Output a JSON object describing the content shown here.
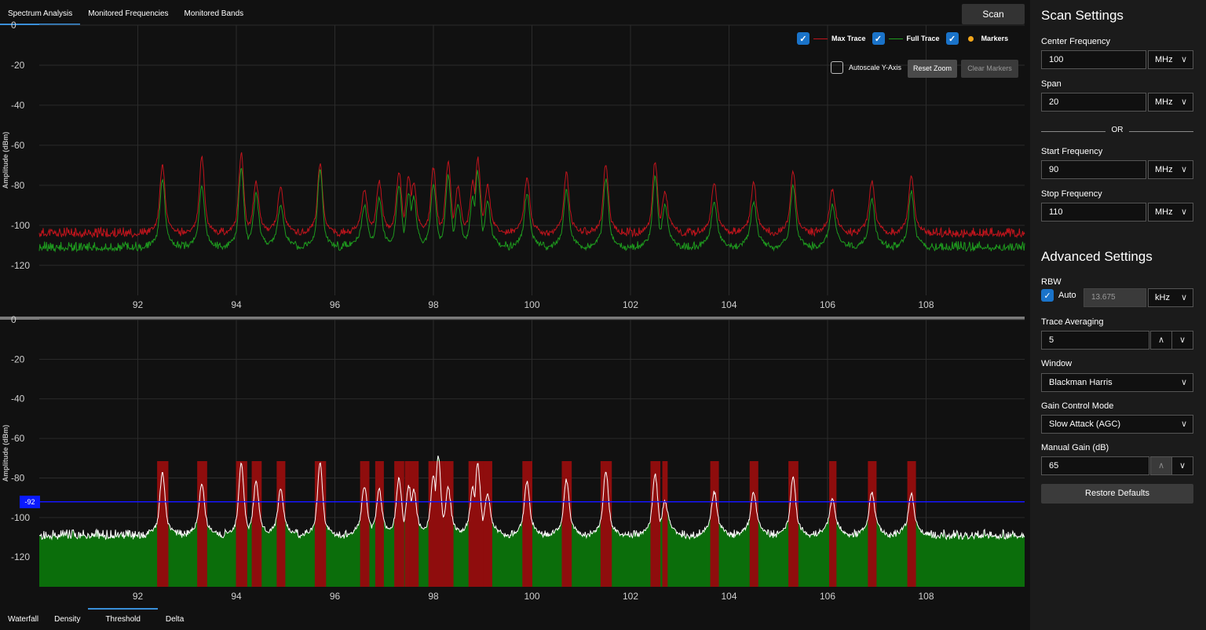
{
  "tabs": [
    "Spectrum Analysis",
    "Monitored Frequencies",
    "Monitored Bands"
  ],
  "scan_button": "Scan",
  "legend": {
    "max_trace": "Max Trace",
    "full_trace": "Full Trace",
    "markers": "Markers",
    "autoscale": "Autoscale Y-Axis",
    "reset_zoom": "Reset Zoom",
    "clear_markers": "Clear Markers"
  },
  "threshold_value": "-92",
  "bottom_tabs": [
    "Waterfall",
    "Density",
    "Threshold",
    "Delta"
  ],
  "settings": {
    "title": "Scan Settings",
    "center_label": "Center Frequency",
    "center_value": "100",
    "center_unit": "MHz",
    "span_label": "Span",
    "span_value": "20",
    "span_unit": "MHz",
    "or": "OR",
    "start_label": "Start Frequency",
    "start_value": "90",
    "start_unit": "MHz",
    "stop_label": "Stop Frequency",
    "stop_value": "110",
    "stop_unit": "MHz"
  },
  "advanced": {
    "title": "Advanced Settings",
    "rbw_label": "RBW",
    "rbw_auto": "Auto",
    "rbw_value": "13.675",
    "rbw_unit": "kHz",
    "avg_label": "Trace Averaging",
    "avg_value": "5",
    "window_label": "Window",
    "window_value": "Blackman Harris",
    "gain_mode_label": "Gain Control Mode",
    "gain_mode_value": "Slow Attack (AGC)",
    "manual_gain_label": "Manual Gain (dB)",
    "manual_gain_value": "65",
    "restore": "Restore Defaults"
  },
  "colors": {
    "max": "#c0141c",
    "full": "#1e9a1e",
    "threshold": "#1515ff",
    "fill_below": "#0b6e0b",
    "fill_above": "#8f0d0d",
    "accent": "#3a8fd9"
  },
  "chart_data": [
    {
      "type": "line",
      "ylabel": "Amplitude (dBm)",
      "xlim": [
        90,
        110
      ],
      "ylim": [
        -135,
        0
      ],
      "x_ticks": [
        92,
        94,
        96,
        98,
        100,
        102,
        104,
        106,
        108
      ],
      "y_ticks": [
        0,
        -20,
        -40,
        -60,
        -80,
        -100,
        -120
      ],
      "series": [
        {
          "name": "Max Trace",
          "color": "#c0141c",
          "peaks": [
            [
              92.5,
              -70
            ],
            [
              93.3,
              -66
            ],
            [
              94.1,
              -64
            ],
            [
              94.4,
              -78
            ],
            [
              94.9,
              -81
            ],
            [
              95.7,
              -69
            ],
            [
              96.6,
              -82
            ],
            [
              96.9,
              -78
            ],
            [
              97.3,
              -73
            ],
            [
              97.5,
              -75
            ],
            [
              97.6,
              -78
            ],
            [
              98.0,
              -71
            ],
            [
              98.3,
              -68
            ],
            [
              98.5,
              -80
            ],
            [
              98.8,
              -78
            ],
            [
              98.9,
              -66
            ],
            [
              99.1,
              -80
            ],
            [
              99.9,
              -76
            ],
            [
              100.7,
              -74
            ],
            [
              101.5,
              -69
            ],
            [
              102.5,
              -68
            ],
            [
              102.7,
              -83
            ],
            [
              103.7,
              -79
            ],
            [
              104.5,
              -79
            ],
            [
              105.3,
              -73
            ],
            [
              106.1,
              -82
            ],
            [
              106.9,
              -78
            ],
            [
              107.7,
              -75
            ]
          ],
          "noise_floor": -105
        },
        {
          "name": "Full Trace",
          "color": "#1e9a1e",
          "peaks": [
            [
              92.5,
              -77
            ],
            [
              93.3,
              -80
            ],
            [
              94.1,
              -71
            ],
            [
              94.4,
              -84
            ],
            [
              94.9,
              -90
            ],
            [
              95.7,
              -72
            ],
            [
              96.6,
              -90
            ],
            [
              96.9,
              -86
            ],
            [
              97.3,
              -80
            ],
            [
              97.5,
              -84
            ],
            [
              97.6,
              -86
            ],
            [
              98.0,
              -79
            ],
            [
              98.3,
              -75
            ],
            [
              98.5,
              -89
            ],
            [
              98.8,
              -86
            ],
            [
              98.9,
              -73
            ],
            [
              99.1,
              -88
            ],
            [
              99.9,
              -84
            ],
            [
              100.7,
              -82
            ],
            [
              101.5,
              -77
            ],
            [
              102.5,
              -75
            ],
            [
              102.7,
              -90
            ],
            [
              103.7,
              -88
            ],
            [
              104.5,
              -88
            ],
            [
              105.3,
              -80
            ],
            [
              106.1,
              -90
            ],
            [
              106.9,
              -87
            ],
            [
              107.7,
              -83
            ]
          ],
          "noise_floor": -112
        }
      ]
    },
    {
      "type": "area",
      "ylabel": "Amplitude (dBm)",
      "xlim": [
        90,
        110
      ],
      "ylim": [
        -135,
        0
      ],
      "x_ticks": [
        92,
        94,
        96,
        98,
        100,
        102,
        104,
        106,
        108
      ],
      "y_ticks": [
        0,
        -20,
        -40,
        -60,
        -80,
        -100,
        -120
      ],
      "threshold": -92,
      "series": [
        {
          "name": "Threshold",
          "color": "#ffffff",
          "peaks": [
            [
              92.5,
              -77
            ],
            [
              93.3,
              -83
            ],
            [
              94.1,
              -72
            ],
            [
              94.4,
              -82
            ],
            [
              94.9,
              -86
            ],
            [
              95.7,
              -72
            ],
            [
              96.6,
              -84
            ],
            [
              96.9,
              -86
            ],
            [
              97.3,
              -80
            ],
            [
              97.5,
              -84
            ],
            [
              97.6,
              -86
            ],
            [
              98.0,
              -79
            ],
            [
              98.1,
              -69
            ],
            [
              98.3,
              -85
            ],
            [
              98.8,
              -85
            ],
            [
              98.9,
              -73
            ],
            [
              99.1,
              -88
            ],
            [
              99.9,
              -82
            ],
            [
              100.7,
              -81
            ],
            [
              101.5,
              -76
            ],
            [
              102.5,
              -78
            ],
            [
              102.7,
              -92
            ],
            [
              103.7,
              -87
            ],
            [
              104.5,
              -87
            ],
            [
              105.3,
              -79
            ],
            [
              106.1,
              -91
            ],
            [
              106.9,
              -87
            ],
            [
              107.7,
              -88
            ]
          ],
          "noise_floor": -110
        }
      ]
    }
  ]
}
